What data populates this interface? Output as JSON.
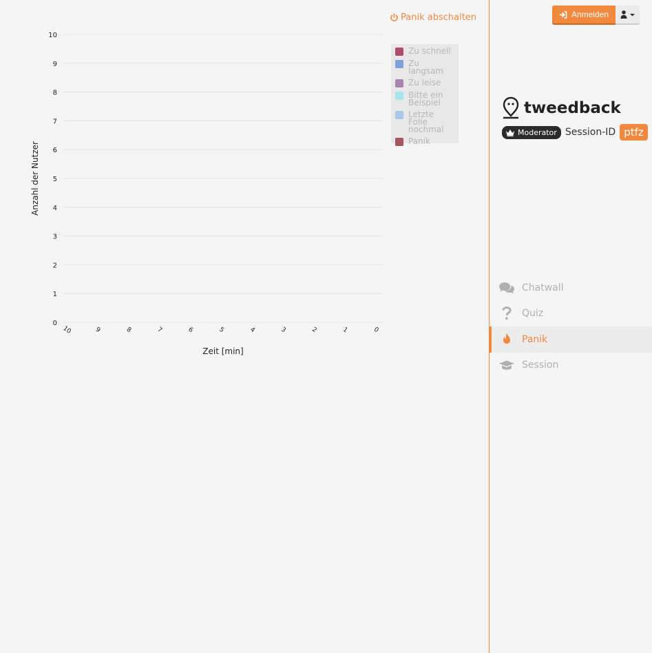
{
  "panic_toggle": {
    "label": "Panik abschalten",
    "icon": "power-icon"
  },
  "chart_data": {
    "type": "line",
    "ylabel": "Anzahl der Nutzer",
    "xlabel": "Zeit [min]",
    "ylim": [
      0,
      10
    ],
    "y_ticks": [
      "0",
      "1",
      "2",
      "3",
      "4",
      "5",
      "6",
      "7",
      "8",
      "9",
      "10"
    ],
    "x_ticks": [
      "10",
      "9",
      "8",
      "7",
      "6",
      "5",
      "4",
      "3",
      "2",
      "1",
      "0"
    ],
    "grid": true,
    "legend_position": "right",
    "series": [
      {
        "name": "Zu schnell",
        "color": "#b14b6a",
        "values": []
      },
      {
        "name": "Zu langsam",
        "color": "#7ea1d8",
        "values": []
      },
      {
        "name": "Zu leise",
        "color": "#a986b2",
        "values": []
      },
      {
        "name": "Bitte ein Beispiel",
        "color": "#a8e4f0",
        "values": []
      },
      {
        "name": "Letzte Folie nochmal",
        "color": "#a9c7e6",
        "values": []
      },
      {
        "name": "Panik",
        "color": "#a3575f",
        "values": []
      }
    ]
  },
  "header": {
    "login_label": "Anmelden",
    "login_icon": "sign-in-icon",
    "user_icon": "user-icon"
  },
  "brand": {
    "name": "tweedback",
    "role_badge": "Moderator",
    "role_icon": "crown-icon",
    "session_label": "Session-ID",
    "session_id": "ptfz"
  },
  "nav": [
    {
      "label": "Chatwall",
      "icon": "comments-icon",
      "active": false
    },
    {
      "label": "Quiz",
      "icon": "question-icon",
      "active": false
    },
    {
      "label": "Panik",
      "icon": "fire-icon",
      "active": true
    },
    {
      "label": "Session",
      "icon": "graduation-cap-icon",
      "active": false
    }
  ],
  "colors": {
    "accent": "#f0883e",
    "nav_inactive": "#b0b0b0"
  }
}
